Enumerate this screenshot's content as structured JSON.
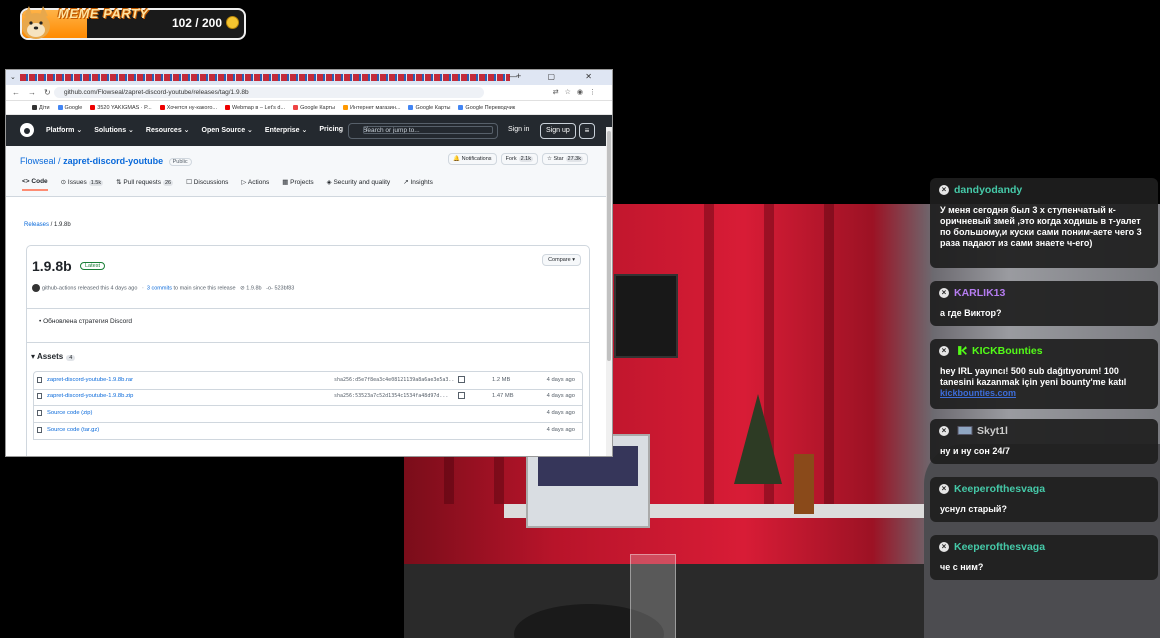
{
  "meme_widget": {
    "title": "MEME PARTY",
    "count": "102 / 200",
    "progress": 0.51,
    "fill_color": "#ff8a00",
    "icon": "doge-icon",
    "coin_icon": "coin-icon"
  },
  "browser": {
    "new_tab_symbol": "+",
    "window_controls": "— ▢ ✕",
    "url": "github.com/Flowseal/zapret-discord-youtube/releases/tag/1.9.8b",
    "bookmarks": [
      "Діти",
      "Google",
      "3520 YAKIGMAS · P...",
      "Хочется ну-какого...",
      "Webmap в – Let's d...",
      "Google Карты",
      "Интернет магазин...",
      "Google Карты",
      "Google Переводчик"
    ],
    "github": {
      "nav": [
        "Platform",
        "Solutions",
        "Resources",
        "Open Source",
        "Enterprise",
        "Pricing"
      ],
      "search_placeholder": "Search or jump to...",
      "search_key": "/",
      "sign_in": "Sign in",
      "sign_up": "Sign up",
      "owner": "Flowseal",
      "separator": "/",
      "repo": "zapret-discord-youtube",
      "visibility": "Public",
      "notifications": "Notifications",
      "fork_label": "Fork",
      "fork_count": "2.1k",
      "star_label": "Star",
      "star_count": "27.3k",
      "tabs": [
        {
          "label": "Code",
          "count": ""
        },
        {
          "label": "Issues",
          "count": "1.5k"
        },
        {
          "label": "Pull requests",
          "count": "26"
        },
        {
          "label": "Discussions",
          "count": ""
        },
        {
          "label": "Actions",
          "count": ""
        },
        {
          "label": "Projects",
          "count": ""
        },
        {
          "label": "Security and quality",
          "count": ""
        },
        {
          "label": "Insights",
          "count": ""
        }
      ],
      "breadcrumb_releases": "Releases",
      "breadcrumb_current": "1.9.8b",
      "release": {
        "title": "1.9.8b",
        "badge": "Latest",
        "compare": "Compare",
        "author": "github-actions",
        "released": "released this 4 days ago",
        "commits": "3 commits",
        "commits_suffix": "to main since this release",
        "tag": "1.9.8b",
        "commit_hash": "523bf83",
        "note": "Обновлена стратегия Discord",
        "assets_label": "Assets",
        "assets_count": "4",
        "assets": [
          {
            "name": "zapret-discord-youtube-1.9.8b.rar",
            "sha": "sha256:d5e7f8ea3c4e08121139a8a6ae3e5a3...",
            "size": "1.2 MB",
            "date": "4 days ago"
          },
          {
            "name": "zapret-discord-youtube-1.9.8b.zip",
            "sha": "sha256:53523a7c52d1354c1534fa48d97d...",
            "size": "1.47 MB",
            "date": "4 days ago"
          },
          {
            "name": "Source code (zip)",
            "sha": "",
            "size": "",
            "date": "4 days ago"
          },
          {
            "name": "Source code (tar.gz)",
            "sha": "",
            "size": "",
            "date": "4 days ago"
          }
        ]
      }
    }
  },
  "chat": {
    "messages": [
      {
        "user": "dandyodandy",
        "color": "#45c9a8",
        "text": "У меня сегодня был 3 х ступенчатый к-оричневый змей ,это когда ходишь в т-уалет по большому,и куски сами поним-аете чего 3 раза падают из сами знаете ч-его)",
        "badge": ""
      },
      {
        "user": "KARLIK13",
        "color": "#b57cf0",
        "text": "а где Виктор?",
        "badge": ""
      },
      {
        "user": "KICKBounties",
        "color": "#53fc18",
        "text": "hey IRL yayıncı! 500 sub dağıtıyorum! 100 tanesini kazanmak için yeni bounty'me katıl",
        "link": "kickbounties.com",
        "badge": "kick-icon"
      },
      {
        "user": "Skyt1l",
        "color": "#cccccc",
        "text": "ну и ну сон 24/7",
        "badge": "cube-icon"
      },
      {
        "user": "Keeperofthesvaga",
        "color": "#45c9a8",
        "text": "уснул старый?",
        "badge": ""
      },
      {
        "user": "Keeperofthesvaga",
        "color": "#45c9a8",
        "text": "че с ним?",
        "badge": ""
      }
    ]
  }
}
